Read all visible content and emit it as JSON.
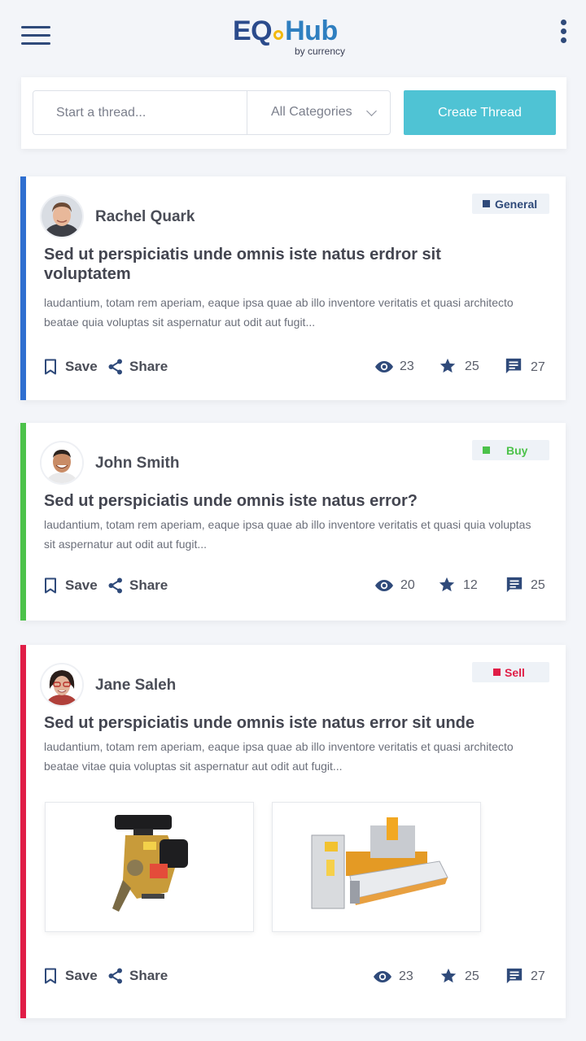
{
  "app": {
    "logo_main_left": "EQ",
    "logo_main_right": "Hub",
    "logo_sub": "by currency"
  },
  "toolbar": {
    "search_placeholder": "Start a thread...",
    "category_selected": "All Categories",
    "create_label": "Create Thread"
  },
  "icons": {
    "menu": "hamburger-menu-icon",
    "more": "more-vertical-icon",
    "save": "bookmark-icon",
    "share": "share-icon",
    "views": "eye-icon",
    "stars": "star-icon",
    "comments": "comment-icon"
  },
  "colors": {
    "general": "#2f4a7a",
    "buy": "#4cc24a",
    "sell": "#e01e47",
    "create_button": "#4fc3d4",
    "icon": "#2f4a7a"
  },
  "threads": [
    {
      "author": "Rachel Quark",
      "category": "General",
      "title": "Sed ut perspiciatis unde omnis iste natus erdror sit voluptatem",
      "excerpt": "laudantium, totam rem aperiam, eaque ipsa quae ab illo inventore veritatis et quasi architecto beatae quia voluptas sit aspernatur aut odit aut fugit...",
      "save_label": "Save",
      "share_label": "Share",
      "views": "23",
      "stars": "25",
      "comments": "27"
    },
    {
      "author": "John Smith",
      "category": "Buy",
      "title": "Sed ut perspiciatis unde omnis iste natus error?",
      "excerpt": "laudantium, totam rem aperiam, eaque ipsa quae ab illo inventore veritatis et quasi quia voluptas sit aspernatur aut odit aut fugit...",
      "save_label": "Save",
      "share_label": "Share",
      "views": "20",
      "stars": "12",
      "comments": "25"
    },
    {
      "author": "Jane Saleh",
      "category": "Sell",
      "title": "Sed ut perspiciatis unde omnis iste natus error sit unde",
      "excerpt": "laudantium, totam rem aperiam, eaque ipsa quae ab illo inventore veritatis et quasi architecto beatae vitae quia voluptas sit aspernatur aut odit aut fugit...",
      "save_label": "Save",
      "share_label": "Share",
      "views": "23",
      "stars": "25",
      "comments": "27"
    }
  ]
}
